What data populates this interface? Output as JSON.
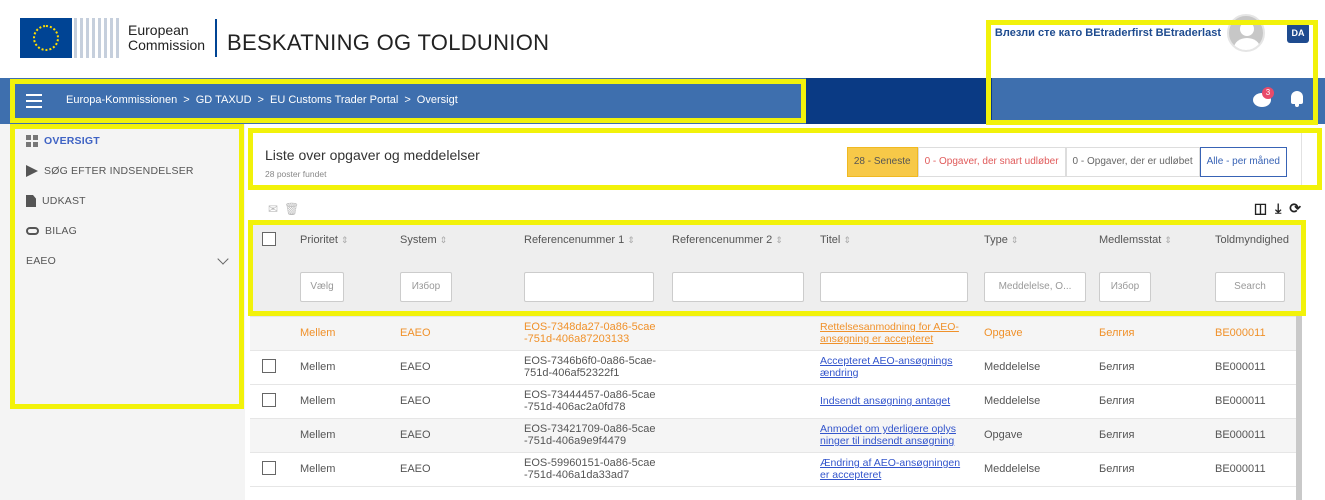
{
  "header": {
    "logo_line1": "European",
    "logo_line2": "Commission",
    "site_title": "BESKATNING OG TOLDUNION",
    "user_text": "Влезли сте като BEtraderfirst BEtraderlast",
    "lang": "DA"
  },
  "breadcrumb": [
    "Europa-Kommissionen",
    "GD TAXUD",
    "EU Customs Trader Portal",
    "Oversigt"
  ],
  "breadcrumb_sep": ">",
  "notifications": {
    "chat_count": "3"
  },
  "sidebar": {
    "items": [
      {
        "label": "OVERSIGT",
        "icon": "dashboard-grid-icon"
      },
      {
        "label": "SØG EFTER INDSENDELSER",
        "icon": "send-arrow-icon"
      },
      {
        "label": "UDKAST",
        "icon": "document-icon"
      },
      {
        "label": "BILAG",
        "icon": "attachment-link-icon"
      }
    ],
    "section": "EAEO"
  },
  "panel": {
    "title": "Liste over opgaver og meddelelser",
    "subtitle": "28 poster fundet",
    "filters": [
      "28 - Seneste",
      "0 - Opgaver, der snart udløber",
      "0 - Opgaver, der er udløbet",
      "Alle - per måned"
    ]
  },
  "table": {
    "headers": [
      "Prioritet",
      "System",
      "Referencenummer 1",
      "Referencenummer 2",
      "Titel",
      "Type",
      "Medlemsstat",
      "Toldmyndighed"
    ],
    "filter_placeholders": [
      "Vælg",
      "Избор",
      "",
      "",
      "",
      "Meddelelse, O...",
      "Избор",
      "Search"
    ],
    "rows": [
      {
        "checkbox": false,
        "prio": "Mellem",
        "system": "EAEO",
        "ref1a": "EOS-7348da27-0a86-5cae",
        "ref1b": "-751d-406a87203133",
        "ref2": "",
        "title1": "Rettelsesanmodning for AEO-",
        "title2": "ansøgning er accepteret",
        "type": "Opgave",
        "ms": "Белгия",
        "auth": "BE000011"
      },
      {
        "checkbox": true,
        "prio": "Mellem",
        "system": "EAEO",
        "ref1a": "EOS-7346b6f0-0a86-5cae-",
        "ref1b": "751d-406af52322f1",
        "ref2": "",
        "title1": "Accepteret AEO-ansøgnings",
        "title2": "ændring",
        "type": "Meddelelse",
        "ms": "Белгия",
        "auth": "BE000011"
      },
      {
        "checkbox": true,
        "prio": "Mellem",
        "system": "EAEO",
        "ref1a": "EOS-73444457-0a86-5cae",
        "ref1b": "-751d-406ac2a0fd78",
        "ref2": "",
        "title1": "Indsendt ansøgning antaget",
        "title2": "",
        "type": "Meddelelse",
        "ms": "Белгия",
        "auth": "BE000011"
      },
      {
        "checkbox": false,
        "prio": "Mellem",
        "system": "EAEO",
        "ref1a": "EOS-73421709-0a86-5cae",
        "ref1b": "-751d-406a9e9f4479",
        "ref2": "",
        "title1": "Anmodet om yderligere oplys",
        "title2": "ninger til indsendt ansøgning",
        "type": "Opgave",
        "ms": "Белгия",
        "auth": "BE000011"
      },
      {
        "checkbox": true,
        "prio": "Mellem",
        "system": "EAEO",
        "ref1a": "EOS-59960151-0a86-5cae",
        "ref1b": "-751d-406a1da33ad7",
        "ref2": "",
        "title1": "Ændring af AEO-ansøgningen",
        "title2": "er accepteret",
        "type": "Meddelelse",
        "ms": "Белгия",
        "auth": "BE000011"
      }
    ]
  },
  "colors": {
    "navbar": "#3e6fae",
    "navbar_dark": "#0a3a84",
    "highlight": "#f2f20a",
    "orange_row": "#f0912a",
    "link": "#3355cc"
  }
}
